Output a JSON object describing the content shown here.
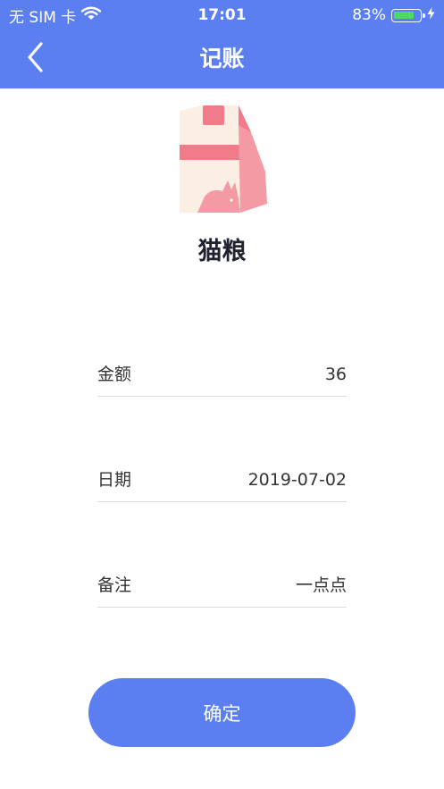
{
  "status_bar": {
    "carrier": "无 SIM 卡",
    "time": "17:01",
    "battery_percent": "83%",
    "battery_level": 0.83,
    "wifi_icon": "wifi-icon",
    "charging_icon": "lightning-icon"
  },
  "nav": {
    "title": "记账",
    "back_icon": "chevron-left-icon"
  },
  "category": {
    "icon": "cat-food-bag-icon",
    "name": "猫粮"
  },
  "form": {
    "amount": {
      "label": "金额",
      "value": "36"
    },
    "date": {
      "label": "日期",
      "value": "2019-07-02"
    },
    "note": {
      "label": "备注",
      "value": "一点点"
    }
  },
  "confirm_label": "确定",
  "colors": {
    "primary": "#5b7ff0",
    "bag_pink": "#f27b8a",
    "bag_cream": "#fbeee4",
    "battery_green": "#4cd964"
  }
}
